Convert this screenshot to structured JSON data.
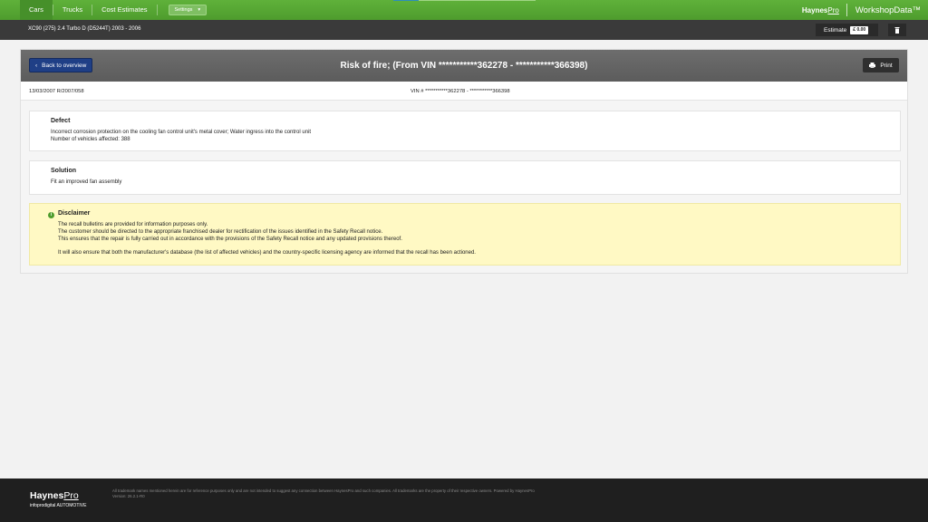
{
  "nav": {
    "tabs": [
      "Cars",
      "Trucks",
      "Cost Estimates"
    ],
    "settings_label": "Settings",
    "brand_haynes": "Haynes",
    "brand_pro": "Pro",
    "brand_product": "WorkshopData™"
  },
  "vehicle": {
    "title": "XC90 (275) 2.4 Turbo D (D5244T) 2003 - 2006",
    "estimate_label": "Estimate",
    "estimate_value": "£ 0.00"
  },
  "recall": {
    "back_label": "Back to overview",
    "title": "Risk of fire; (From VIN ***********362278 - ***********366398)",
    "print_label": "Print",
    "date_ref": "13/03/2007 R/2007/058",
    "vin_range": "VIN # ***********362278 - ***********366398",
    "defect": {
      "heading": "Defect",
      "line1": "Incorrect corrosion protection on the cooling fan control unit's metal cover; Water ingress into the control unit",
      "line2": "Number of vehicles affected: 388"
    },
    "solution": {
      "heading": "Solution",
      "line1": "Fit an improved fan assembly"
    },
    "disclaimer": {
      "heading": "Disclaimer",
      "line1": "The recall bulletins are provided for information purposes only.",
      "line2": "The customer should be directed to the appropriate franchised dealer for rectification of the issues identified in the Safety Recall notice.",
      "line3": "This ensures that the repair is fully carried out in accordance with the provisions of the Safety Recall notice and any updated provisions thereof.",
      "line4": "It will also ensure that both the manufacturer's database (the list of affected vehicles) and the country-specific licensing agency are informed that the recall has been actioned."
    }
  },
  "footer": {
    "logo_haynes": "Haynes",
    "logo_pro": "Pro",
    "logo_sub": "infoprodigital AUTOMOTIVE",
    "legal": "All trademark names mentioned herein are for reference purposes only and are not intended to suggest any connection between HaynesPro and such companies. All trademarks are the property of their respective owners. Powered by HaynesPro",
    "version": "Version: 26.2.1-R0"
  },
  "colors": {
    "nav_green": "#56a832",
    "back_button": "#1f3f86",
    "disclaimer_bg": "#fff9c4"
  }
}
